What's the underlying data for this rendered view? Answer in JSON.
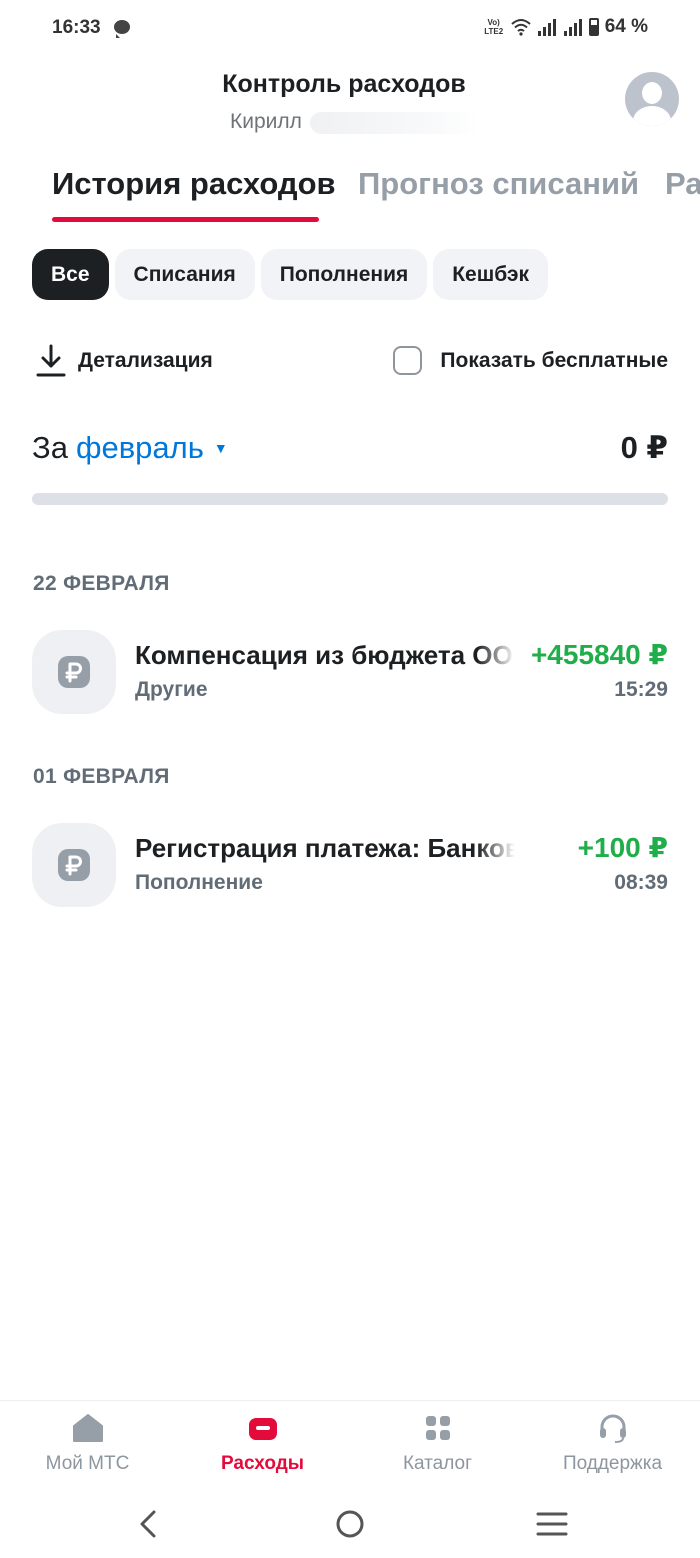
{
  "status_bar": {
    "time": "16:33",
    "network": "Vo) LTE2",
    "battery": "64 %"
  },
  "header": {
    "title": "Контроль расходов",
    "user_name": "Кирилл"
  },
  "tabs": [
    {
      "label": "История расходов",
      "active": true
    },
    {
      "label": "Прогноз списаний",
      "active": false
    },
    {
      "label": "Ра",
      "active": false
    }
  ],
  "filters": [
    {
      "label": "Все",
      "active": true
    },
    {
      "label": "Списания",
      "active": false
    },
    {
      "label": "Пополнения",
      "active": false
    },
    {
      "label": "Кешбэк",
      "active": false
    }
  ],
  "actions": {
    "detail_label": "Детализация",
    "show_free_label": "Показать бесплатные",
    "show_free_checked": false
  },
  "period": {
    "prefix": "За",
    "month": "февраль",
    "total": "0 ₽",
    "progress": 0
  },
  "groups": [
    {
      "date": "22 ФЕВРАЛЯ",
      "transactions": [
        {
          "title": "Компенсация из бюджета ООО",
          "category": "Другие",
          "amount": "+455840 ₽",
          "time": "15:29",
          "icon": "ruble-icon"
        }
      ]
    },
    {
      "date": "01 ФЕВРАЛЯ",
      "transactions": [
        {
          "title": "Регистрация платежа: Банковская карта",
          "category": "Пополнение",
          "amount": "+100 ₽",
          "time": "08:39",
          "icon": "ruble-icon"
        }
      ]
    }
  ],
  "bottom_nav": [
    {
      "label": "Мой МТС",
      "icon": "home-icon",
      "active": false
    },
    {
      "label": "Расходы",
      "icon": "wallet-icon",
      "active": true
    },
    {
      "label": "Каталог",
      "icon": "grid-icon",
      "active": false
    },
    {
      "label": "Поддержка",
      "icon": "headset-icon",
      "active": false
    }
  ],
  "colors": {
    "accent_red": "#e30b3c",
    "link_blue": "#0077db",
    "positive_green": "#1fae4a",
    "text_primary": "#1d2023",
    "text_secondary": "#626c77"
  }
}
